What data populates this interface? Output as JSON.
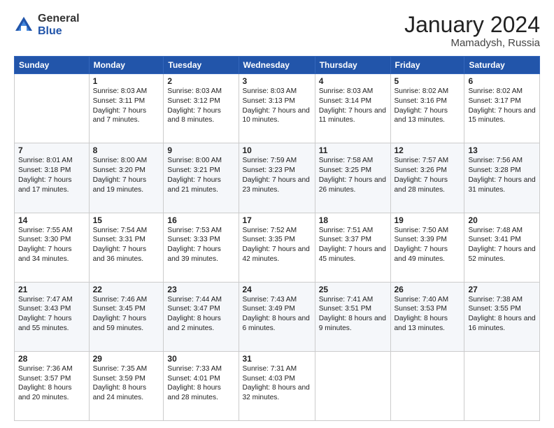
{
  "header": {
    "logo_general": "General",
    "logo_blue": "Blue",
    "month_year": "January 2024",
    "location": "Mamadysh, Russia"
  },
  "weekdays": [
    "Sunday",
    "Monday",
    "Tuesday",
    "Wednesday",
    "Thursday",
    "Friday",
    "Saturday"
  ],
  "weeks": [
    [
      {
        "day": "",
        "sunrise": "",
        "sunset": "",
        "daylight": ""
      },
      {
        "day": "1",
        "sunrise": "Sunrise: 8:03 AM",
        "sunset": "Sunset: 3:11 PM",
        "daylight": "Daylight: 7 hours and 7 minutes."
      },
      {
        "day": "2",
        "sunrise": "Sunrise: 8:03 AM",
        "sunset": "Sunset: 3:12 PM",
        "daylight": "Daylight: 7 hours and 8 minutes."
      },
      {
        "day": "3",
        "sunrise": "Sunrise: 8:03 AM",
        "sunset": "Sunset: 3:13 PM",
        "daylight": "Daylight: 7 hours and 10 minutes."
      },
      {
        "day": "4",
        "sunrise": "Sunrise: 8:03 AM",
        "sunset": "Sunset: 3:14 PM",
        "daylight": "Daylight: 7 hours and 11 minutes."
      },
      {
        "day": "5",
        "sunrise": "Sunrise: 8:02 AM",
        "sunset": "Sunset: 3:16 PM",
        "daylight": "Daylight: 7 hours and 13 minutes."
      },
      {
        "day": "6",
        "sunrise": "Sunrise: 8:02 AM",
        "sunset": "Sunset: 3:17 PM",
        "daylight": "Daylight: 7 hours and 15 minutes."
      }
    ],
    [
      {
        "day": "7",
        "sunrise": "Sunrise: 8:01 AM",
        "sunset": "Sunset: 3:18 PM",
        "daylight": "Daylight: 7 hours and 17 minutes."
      },
      {
        "day": "8",
        "sunrise": "Sunrise: 8:00 AM",
        "sunset": "Sunset: 3:20 PM",
        "daylight": "Daylight: 7 hours and 19 minutes."
      },
      {
        "day": "9",
        "sunrise": "Sunrise: 8:00 AM",
        "sunset": "Sunset: 3:21 PM",
        "daylight": "Daylight: 7 hours and 21 minutes."
      },
      {
        "day": "10",
        "sunrise": "Sunrise: 7:59 AM",
        "sunset": "Sunset: 3:23 PM",
        "daylight": "Daylight: 7 hours and 23 minutes."
      },
      {
        "day": "11",
        "sunrise": "Sunrise: 7:58 AM",
        "sunset": "Sunset: 3:25 PM",
        "daylight": "Daylight: 7 hours and 26 minutes."
      },
      {
        "day": "12",
        "sunrise": "Sunrise: 7:57 AM",
        "sunset": "Sunset: 3:26 PM",
        "daylight": "Daylight: 7 hours and 28 minutes."
      },
      {
        "day": "13",
        "sunrise": "Sunrise: 7:56 AM",
        "sunset": "Sunset: 3:28 PM",
        "daylight": "Daylight: 7 hours and 31 minutes."
      }
    ],
    [
      {
        "day": "14",
        "sunrise": "Sunrise: 7:55 AM",
        "sunset": "Sunset: 3:30 PM",
        "daylight": "Daylight: 7 hours and 34 minutes."
      },
      {
        "day": "15",
        "sunrise": "Sunrise: 7:54 AM",
        "sunset": "Sunset: 3:31 PM",
        "daylight": "Daylight: 7 hours and 36 minutes."
      },
      {
        "day": "16",
        "sunrise": "Sunrise: 7:53 AM",
        "sunset": "Sunset: 3:33 PM",
        "daylight": "Daylight: 7 hours and 39 minutes."
      },
      {
        "day": "17",
        "sunrise": "Sunrise: 7:52 AM",
        "sunset": "Sunset: 3:35 PM",
        "daylight": "Daylight: 7 hours and 42 minutes."
      },
      {
        "day": "18",
        "sunrise": "Sunrise: 7:51 AM",
        "sunset": "Sunset: 3:37 PM",
        "daylight": "Daylight: 7 hours and 45 minutes."
      },
      {
        "day": "19",
        "sunrise": "Sunrise: 7:50 AM",
        "sunset": "Sunset: 3:39 PM",
        "daylight": "Daylight: 7 hours and 49 minutes."
      },
      {
        "day": "20",
        "sunrise": "Sunrise: 7:48 AM",
        "sunset": "Sunset: 3:41 PM",
        "daylight": "Daylight: 7 hours and 52 minutes."
      }
    ],
    [
      {
        "day": "21",
        "sunrise": "Sunrise: 7:47 AM",
        "sunset": "Sunset: 3:43 PM",
        "daylight": "Daylight: 7 hours and 55 minutes."
      },
      {
        "day": "22",
        "sunrise": "Sunrise: 7:46 AM",
        "sunset": "Sunset: 3:45 PM",
        "daylight": "Daylight: 7 hours and 59 minutes."
      },
      {
        "day": "23",
        "sunrise": "Sunrise: 7:44 AM",
        "sunset": "Sunset: 3:47 PM",
        "daylight": "Daylight: 8 hours and 2 minutes."
      },
      {
        "day": "24",
        "sunrise": "Sunrise: 7:43 AM",
        "sunset": "Sunset: 3:49 PM",
        "daylight": "Daylight: 8 hours and 6 minutes."
      },
      {
        "day": "25",
        "sunrise": "Sunrise: 7:41 AM",
        "sunset": "Sunset: 3:51 PM",
        "daylight": "Daylight: 8 hours and 9 minutes."
      },
      {
        "day": "26",
        "sunrise": "Sunrise: 7:40 AM",
        "sunset": "Sunset: 3:53 PM",
        "daylight": "Daylight: 8 hours and 13 minutes."
      },
      {
        "day": "27",
        "sunrise": "Sunrise: 7:38 AM",
        "sunset": "Sunset: 3:55 PM",
        "daylight": "Daylight: 8 hours and 16 minutes."
      }
    ],
    [
      {
        "day": "28",
        "sunrise": "Sunrise: 7:36 AM",
        "sunset": "Sunset: 3:57 PM",
        "daylight": "Daylight: 8 hours and 20 minutes."
      },
      {
        "day": "29",
        "sunrise": "Sunrise: 7:35 AM",
        "sunset": "Sunset: 3:59 PM",
        "daylight": "Daylight: 8 hours and 24 minutes."
      },
      {
        "day": "30",
        "sunrise": "Sunrise: 7:33 AM",
        "sunset": "Sunset: 4:01 PM",
        "daylight": "Daylight: 8 hours and 28 minutes."
      },
      {
        "day": "31",
        "sunrise": "Sunrise: 7:31 AM",
        "sunset": "Sunset: 4:03 PM",
        "daylight": "Daylight: 8 hours and 32 minutes."
      },
      {
        "day": "",
        "sunrise": "",
        "sunset": "",
        "daylight": ""
      },
      {
        "day": "",
        "sunrise": "",
        "sunset": "",
        "daylight": ""
      },
      {
        "day": "",
        "sunrise": "",
        "sunset": "",
        "daylight": ""
      }
    ]
  ]
}
